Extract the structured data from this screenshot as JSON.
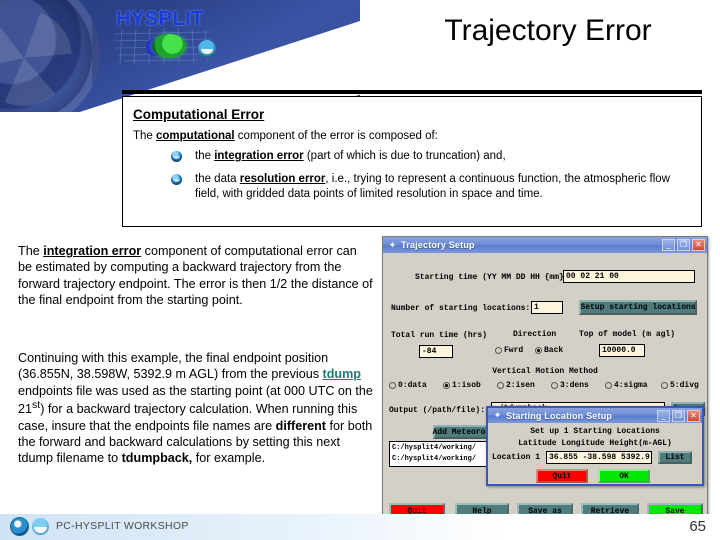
{
  "slide": {
    "title": "Trajectory Error",
    "page_number": "65",
    "logo_text": "HYSPLIT",
    "footer_text": "PC-HYSPLIT WORKSHOP"
  },
  "callout": {
    "heading": "Computational Error",
    "intro_before": "The ",
    "intro_bold": "computational",
    "intro_after": " component of the error is composed of:",
    "bullets": [
      {
        "before": "the ",
        "bold": "integration error",
        "after": " (part of which is due to truncation) and,"
      },
      {
        "before": "the data ",
        "bold": "resolution error",
        "after": ", i.e., trying to represent a continuous function, the atmospheric flow field, with gridded data points of limited resolution in space and time."
      }
    ]
  },
  "body": {
    "para1_before": "The ",
    "para1_bold": "integration error",
    "para1_after": "  component of computational error can be estimated by computing a backward trajectory from the forward trajectory endpoint. The error is then 1/2 the distance of the final endpoint from the starting point.",
    "para2_part1": "Continuing with this example, the final endpoint position (36.855N, 38.598W, 5392.9 m AGL)  from the previous ",
    "para2_link": "tdump",
    "para2_part2": " endpoints file was used as the starting point (at 000 UTC on the 21",
    "para2_sup": "st",
    "para2_part3": ") for a backward trajectory calculation.  When running this case, insure that the endpoints file names are ",
    "para2_bold1": "different",
    "para2_part4": " for both the forward and backward calculations by setting this next tdump filename to ",
    "para2_bold2": "tdumpback,",
    "para2_part5": " for example."
  },
  "traj_window": {
    "title": "Trajectory Setup",
    "min_label": "_",
    "max_label": "❐",
    "close_label": "✕",
    "starting_time_label": "Starting time (YY MM DD HH {mm}):",
    "starting_time_value": "00 02 21 00",
    "num_locations_label": "Number of starting locations:",
    "num_locations_value": "1",
    "setup_locations_button": "Setup starting locations",
    "total_runtime_label": "Total run time (hrs)",
    "total_runtime_value": "-84",
    "direction_label": "Direction",
    "direction_options": [
      "Fwrd",
      "Back"
    ],
    "direction_selected": "Back",
    "top_model_label": "Top of model (m agl)",
    "top_model_value": "10000.0",
    "vertical_motion_label": "Vertical Motion Method",
    "vertical_motion_options": [
      "0:data",
      "1:isob",
      "2:isen",
      "3:dens",
      "4:sigma",
      "5:divg"
    ],
    "vertical_motion_selected": "1:isob",
    "output_label": "Output (/path/file):",
    "output_value": "./tdumpback",
    "browse_button": "Browse",
    "add_meteorology_button": "Add Meteorology Files",
    "met_files": [
      "C:/hysplit4/working/",
      "C:/hysplit4/working/"
    ],
    "bottom_buttons": [
      "Quit",
      "Help",
      "Save as",
      "Retrieve",
      "Save"
    ]
  },
  "location_window": {
    "title": "Starting Location Setup",
    "min_label": "_",
    "max_label": "❐",
    "close_label": "✕",
    "subtitle": "Set up 1 Starting Locations",
    "columns_label": "Latitude Longitude Height(m-AGL)",
    "location_label": "Location 1 :",
    "location_value": "36.855 -38.598 5392.9",
    "list_button": "List",
    "quit_button": "Quit",
    "ok_button": "OK"
  },
  "colors": {
    "banner_blue": "#2c4189",
    "title_black": "#000000",
    "link_teal": "#1f7a78",
    "window_face": "#d4d0c8",
    "field_cream": "#fdf6dc",
    "btn_teal": "#4f7d7d",
    "quit_red": "#ff0000",
    "ok_green": "#00e800",
    "titlebar_blue": "#6f8ed6"
  }
}
